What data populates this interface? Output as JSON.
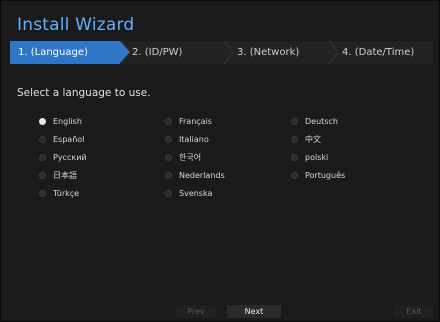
{
  "title": "Install Wizard",
  "steps": [
    {
      "label": "1.  (Language)",
      "active": true
    },
    {
      "label": "2.  (ID/PW)",
      "active": false
    },
    {
      "label": "3.  (Network)",
      "active": false
    },
    {
      "label": "4.  (Date/Time)",
      "active": false
    }
  ],
  "prompt": "Select a language to use.",
  "languages": [
    {
      "label": "English",
      "selected": true
    },
    {
      "label": "Français",
      "selected": false
    },
    {
      "label": "Deutsch",
      "selected": false
    },
    {
      "label": "Español",
      "selected": false
    },
    {
      "label": "Italiano",
      "selected": false
    },
    {
      "label": "中文",
      "selected": false
    },
    {
      "label": "Русский",
      "selected": false
    },
    {
      "label": "한국어",
      "selected": false
    },
    {
      "label": "polski",
      "selected": false
    },
    {
      "label": "日本語",
      "selected": false
    },
    {
      "label": "Nederlands",
      "selected": false
    },
    {
      "label": "Português",
      "selected": false
    },
    {
      "label": "Türkçe",
      "selected": false
    },
    {
      "label": "Svenska",
      "selected": false
    }
  ],
  "buttons": {
    "prev": "Prev",
    "next": "Next",
    "exit": "Exit"
  }
}
